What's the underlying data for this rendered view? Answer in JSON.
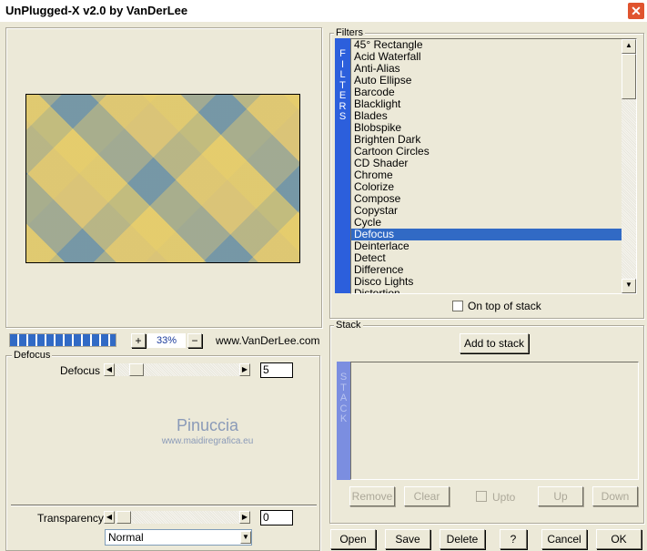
{
  "window": {
    "title": "UnPlugged-X v2.0 by VanDerLee",
    "close": "✕"
  },
  "zoom": {
    "plus": "+",
    "value": "33%",
    "minus": "−",
    "progress_percent": 100
  },
  "website": "www.VanDerLee.com",
  "settings": {
    "group": "Defocus",
    "param_label": "Defocus",
    "param_value": "5",
    "transparency_label": "Transparency",
    "transparency_value": "0",
    "blend_mode": "Normal"
  },
  "watermark": {
    "name": "Pinuccia",
    "url": "www.maidiregrafica.eu"
  },
  "filters": {
    "group": "Filters",
    "side_label": [
      "F",
      "I",
      "L",
      "T",
      "E",
      "R",
      "S"
    ],
    "items": [
      "45° Rectangle",
      "Acid Waterfall",
      "Anti-Alias",
      "Auto Ellipse",
      "Barcode",
      "Blacklight",
      "Blades",
      "Blobspike",
      "Brighten Dark",
      "Cartoon Circles",
      "CD Shader",
      "Chrome",
      "Colorize",
      "Compose",
      "Copystar",
      "Cycle",
      "Defocus",
      "Deinterlace",
      "Detect",
      "Difference",
      "Disco Lights",
      "Distortion"
    ],
    "selected": "Defocus",
    "on_top_label": "On top of stack"
  },
  "stack": {
    "group": "Stack",
    "add": "Add to stack",
    "side_label": [
      "S",
      "T",
      "A",
      "C",
      "K"
    ],
    "remove": "Remove",
    "clear": "Clear",
    "upto": "Upto",
    "up": "Up",
    "down": "Down"
  },
  "footer": {
    "open": "Open",
    "save": "Save",
    "delete": "Delete",
    "help": "?",
    "cancel": "Cancel",
    "ok": "OK"
  },
  "colors": {
    "accent": "#316ac5",
    "filters_bar": "#2c5fdc",
    "stack_bar": "#7b8ee0"
  }
}
